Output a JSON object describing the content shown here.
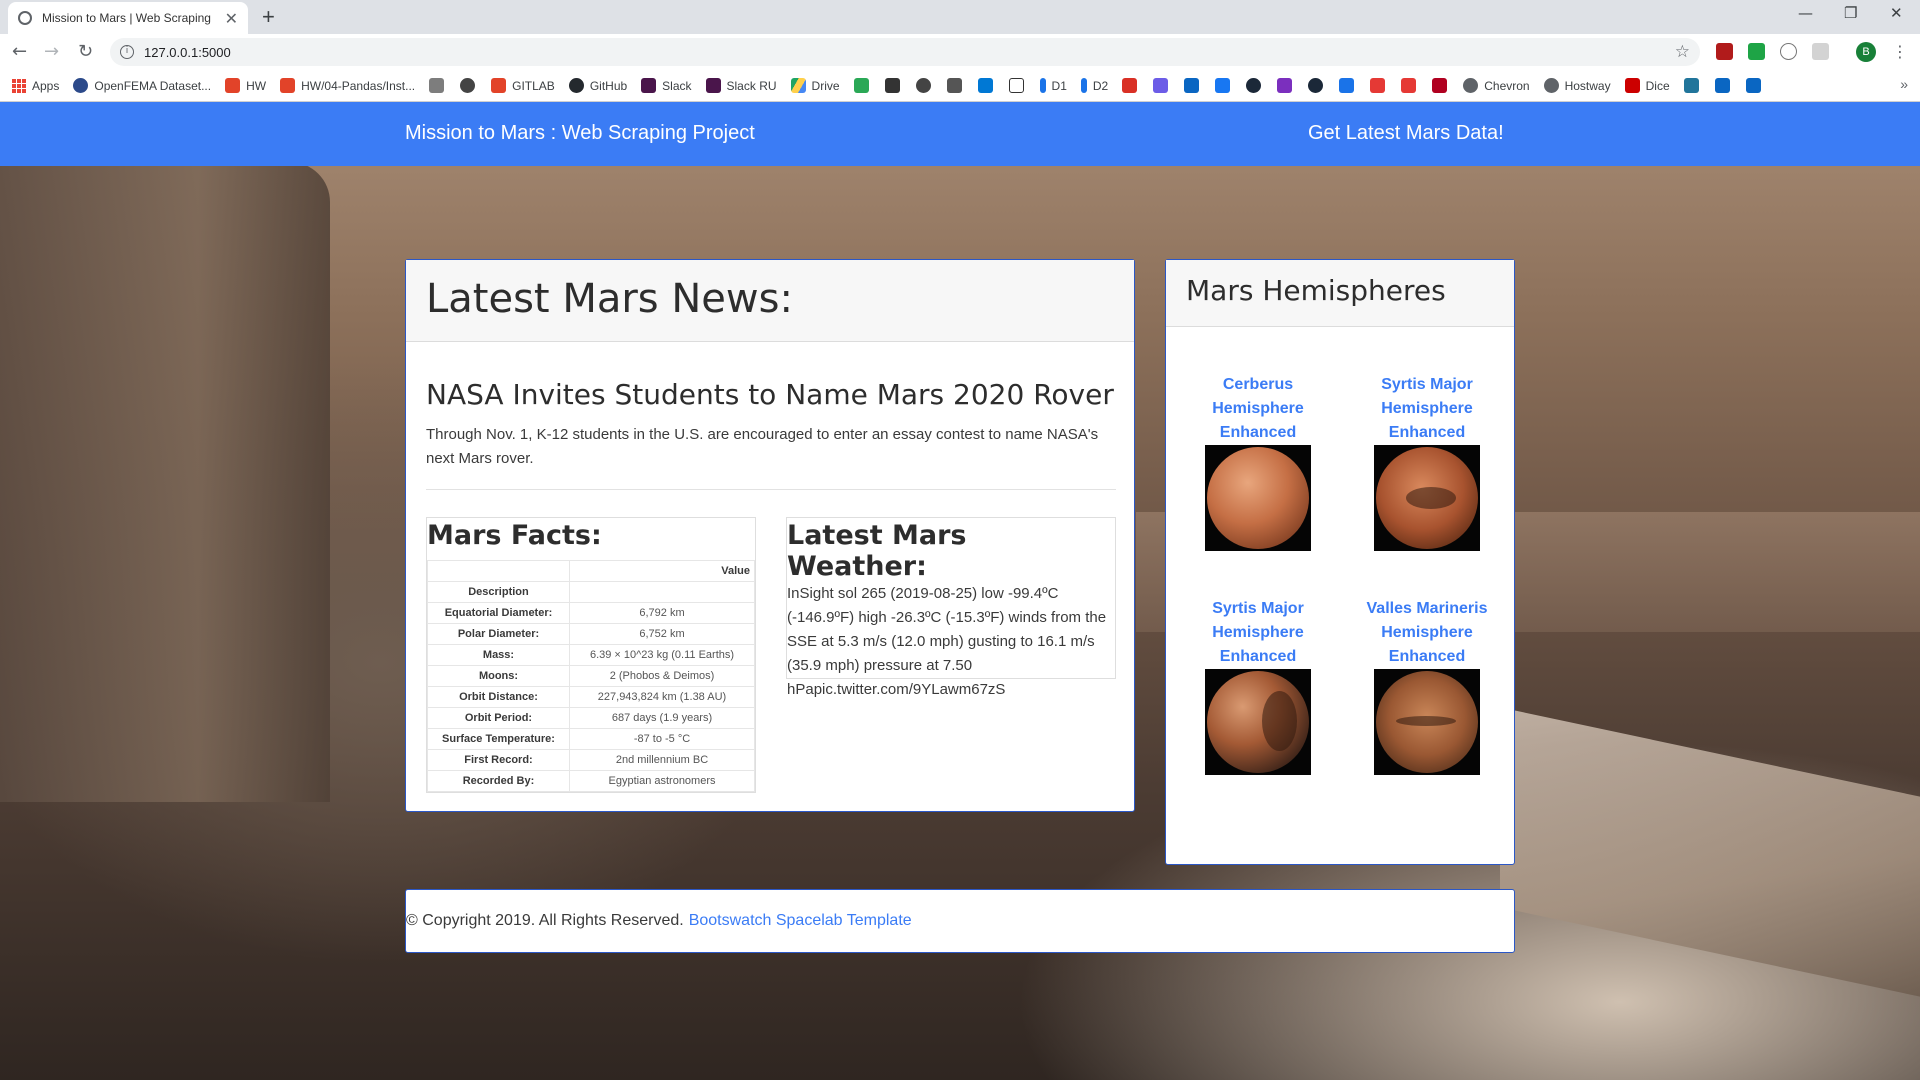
{
  "browser": {
    "tab_title": "Mission to Mars | Web Scraping",
    "url": "127.0.0.1:5000",
    "bookmarks": [
      {
        "label": "Apps",
        "icon": "apps-grid-icon",
        "color": "#ea4335"
      },
      {
        "label": "OpenFEMA Dataset...",
        "icon": "fema-icon",
        "color": "#2c4a8a"
      },
      {
        "label": "HW",
        "icon": "gitlab-icon",
        "color": "#e24329"
      },
      {
        "label": "HW/04-Pandas/Inst...",
        "icon": "gitlab-icon",
        "color": "#e24329"
      },
      {
        "label": "GITLAB",
        "icon": "gitlab-icon",
        "color": "#e24329"
      },
      {
        "label": "GitHub",
        "icon": "github-icon",
        "color": "#24292e"
      },
      {
        "label": "Slack",
        "icon": "slack-icon",
        "color": "#4a154b"
      },
      {
        "label": "Slack RU",
        "icon": "slack-icon",
        "color": "#4a154b"
      },
      {
        "label": "Drive",
        "icon": "drive-icon",
        "color": "#1fa463"
      },
      {
        "label": "D1",
        "icon": "d1-icon",
        "color": "#1a73e8"
      },
      {
        "label": "D2",
        "icon": "d2-icon",
        "color": "#1a73e8"
      },
      {
        "label": "Chevron",
        "icon": "globe-icon",
        "color": "#5f6368"
      },
      {
        "label": "Hostway",
        "icon": "globe-icon",
        "color": "#5f6368"
      },
      {
        "label": "Dice",
        "icon": "dice-icon",
        "color": "#cc0000"
      }
    ]
  },
  "navbar": {
    "brand": "Mission to Mars : Web Scraping Project",
    "action": "Get Latest Mars Data!",
    "color": "#3b7cf5"
  },
  "news": {
    "heading": "Latest Mars News:",
    "title": "NASA Invites Students to Name Mars 2020 Rover",
    "paragraph": "Through Nov. 1, K-12 students in the U.S. are encouraged to enter an essay contest to name NASA's next Mars rover."
  },
  "facts": {
    "title": "Mars Facts:",
    "value_header": "Value",
    "description_header": "Description",
    "rows": [
      {
        "label": "Equatorial Diameter:",
        "value": "6,792 km"
      },
      {
        "label": "Polar Diameter:",
        "value": "6,752 km"
      },
      {
        "label": "Mass:",
        "value": "6.39 × 10^23 kg (0.11 Earths)"
      },
      {
        "label": "Moons:",
        "value": "2 (Phobos & Deimos)"
      },
      {
        "label": "Orbit Distance:",
        "value": "227,943,824 km (1.38 AU)"
      },
      {
        "label": "Orbit Period:",
        "value": "687 days (1.9 years)"
      },
      {
        "label": "Surface Temperature:",
        "value": "-87 to -5 °C"
      },
      {
        "label": "First Record:",
        "value": "2nd millennium BC"
      },
      {
        "label": "Recorded By:",
        "value": "Egyptian astronomers"
      }
    ]
  },
  "weather": {
    "title": "Latest Mars Weather:",
    "text": "InSight sol 265 (2019-08-25) low -99.4ºC (-146.9ºF) high -26.3ºC (-15.3ºF) winds from the SSE at 5.3 m/s (12.0 mph) gusting to 16.1 m/s (35.9 mph) pressure at 7.50 hPapic.twitter.com/9YLawm67zS"
  },
  "hemispheres": {
    "heading": "Mars Hemispheres",
    "items": [
      {
        "line1": "Cerberus",
        "line2": "Hemisphere",
        "line3": "Enhanced"
      },
      {
        "line1": "Syrtis Major",
        "line2": "Hemisphere",
        "line3": "Enhanced"
      },
      {
        "line1": "Syrtis Major",
        "line2": "Hemisphere",
        "line3": "Enhanced"
      },
      {
        "line1": "Valles Marineris",
        "line2": "Hemisphere",
        "line3": "Enhanced"
      }
    ]
  },
  "footer": {
    "copyright": "© Copyright 2019. All Rights Reserved.",
    "link": "Bootswatch Spacelab Template"
  }
}
